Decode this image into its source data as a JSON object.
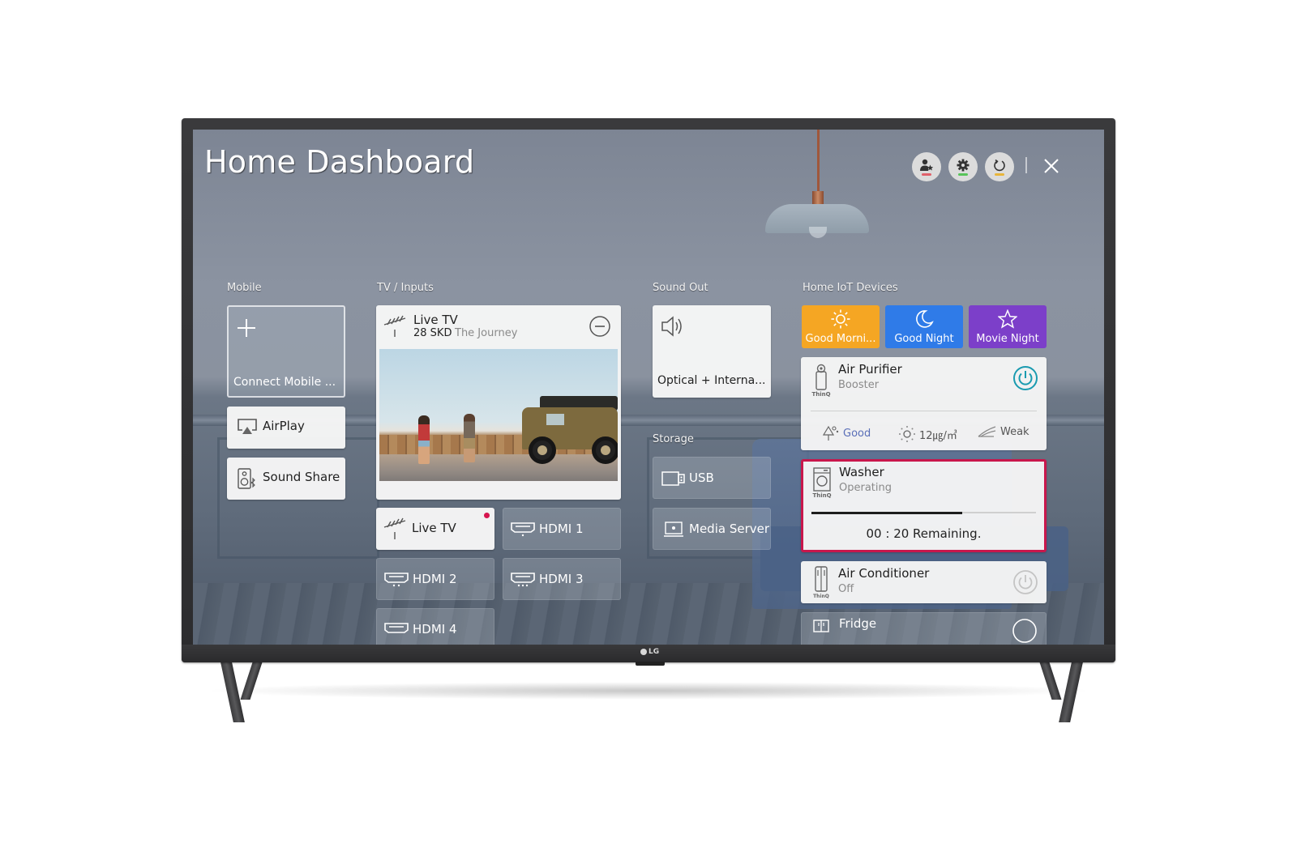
{
  "device": {
    "brand": "LG"
  },
  "header": {
    "title": "Home Dashboard",
    "buttons": [
      {
        "name": "profile",
        "icon": "user-star-icon",
        "indicator_color": "#e0606a"
      },
      {
        "name": "settings",
        "icon": "gear-icon",
        "indicator_color": "#58c45a"
      },
      {
        "name": "refresh",
        "icon": "refresh-icon",
        "indicator_color": "#e8b53a"
      }
    ],
    "close_icon": "close-icon"
  },
  "mobile": {
    "label": "Mobile",
    "connect": {
      "icon": "plus-icon",
      "label": "Connect Mobile ..."
    },
    "items": [
      {
        "icon": "airplay-icon",
        "label": "AirPlay"
      },
      {
        "icon": "sound-share-icon",
        "label": "Sound Share"
      }
    ]
  },
  "tv_inputs": {
    "label": "TV / Inputs",
    "now_playing": {
      "icon": "antenna-icon",
      "title": "Live TV",
      "channel": "28 SKD",
      "program": "The Journey",
      "remove_icon": "minus-circle-icon"
    },
    "inputs": [
      {
        "icon": "antenna-icon",
        "label": "Live TV",
        "active": true,
        "indicator_color": "#d6154f"
      },
      {
        "icon": "hdmi-icon",
        "label": "HDMI 1",
        "active": false
      },
      {
        "icon": "hdmi-icon",
        "label": "HDMI 2",
        "active": false
      },
      {
        "icon": "hdmi-icon",
        "label": "HDMI 3",
        "active": false
      },
      {
        "icon": "hdmi-icon",
        "label": "HDMI 4",
        "active": false
      }
    ]
  },
  "sound_out": {
    "label": "Sound Out",
    "icon": "speaker-icon",
    "value": "Optical + Interna..."
  },
  "storage": {
    "label": "Storage",
    "items": [
      {
        "icon": "usb-icon",
        "label": "USB"
      },
      {
        "icon": "media-server-icon",
        "label": "Media Server"
      }
    ]
  },
  "iot": {
    "label": "Home IoT Devices",
    "scenes": [
      {
        "icon": "sun-icon",
        "label": "Good Morni...",
        "color": "#f5a623"
      },
      {
        "icon": "moon-icon",
        "label": "Good Night",
        "color": "#2f7be8"
      },
      {
        "icon": "star-icon",
        "label": "Movie Night",
        "color": "#7c3fc9"
      }
    ],
    "devices": [
      {
        "icon": "air-purifier-icon",
        "brand": "ThinQ",
        "name": "Air Purifier",
        "status": "Booster",
        "power_on": true,
        "stats": [
          {
            "icon": "tree-icon",
            "value": "Good"
          },
          {
            "icon": "dust-icon",
            "value": "12㎍/㎥"
          },
          {
            "icon": "wind-icon",
            "value": "Weak"
          }
        ]
      },
      {
        "icon": "washer-icon",
        "brand": "ThinQ",
        "name": "Washer",
        "status": "Operating",
        "progress": 0.67,
        "remaining": "00 : 20 Remaining."
      },
      {
        "icon": "air-conditioner-icon",
        "brand": "ThinQ",
        "name": "Air Conditioner",
        "status": "Off",
        "power_on": false
      },
      {
        "icon": "fridge-icon",
        "name": "Fridge"
      }
    ]
  },
  "colors": {
    "accent_power": "#1a9bb0",
    "washer_highlight": "#c8174c"
  }
}
